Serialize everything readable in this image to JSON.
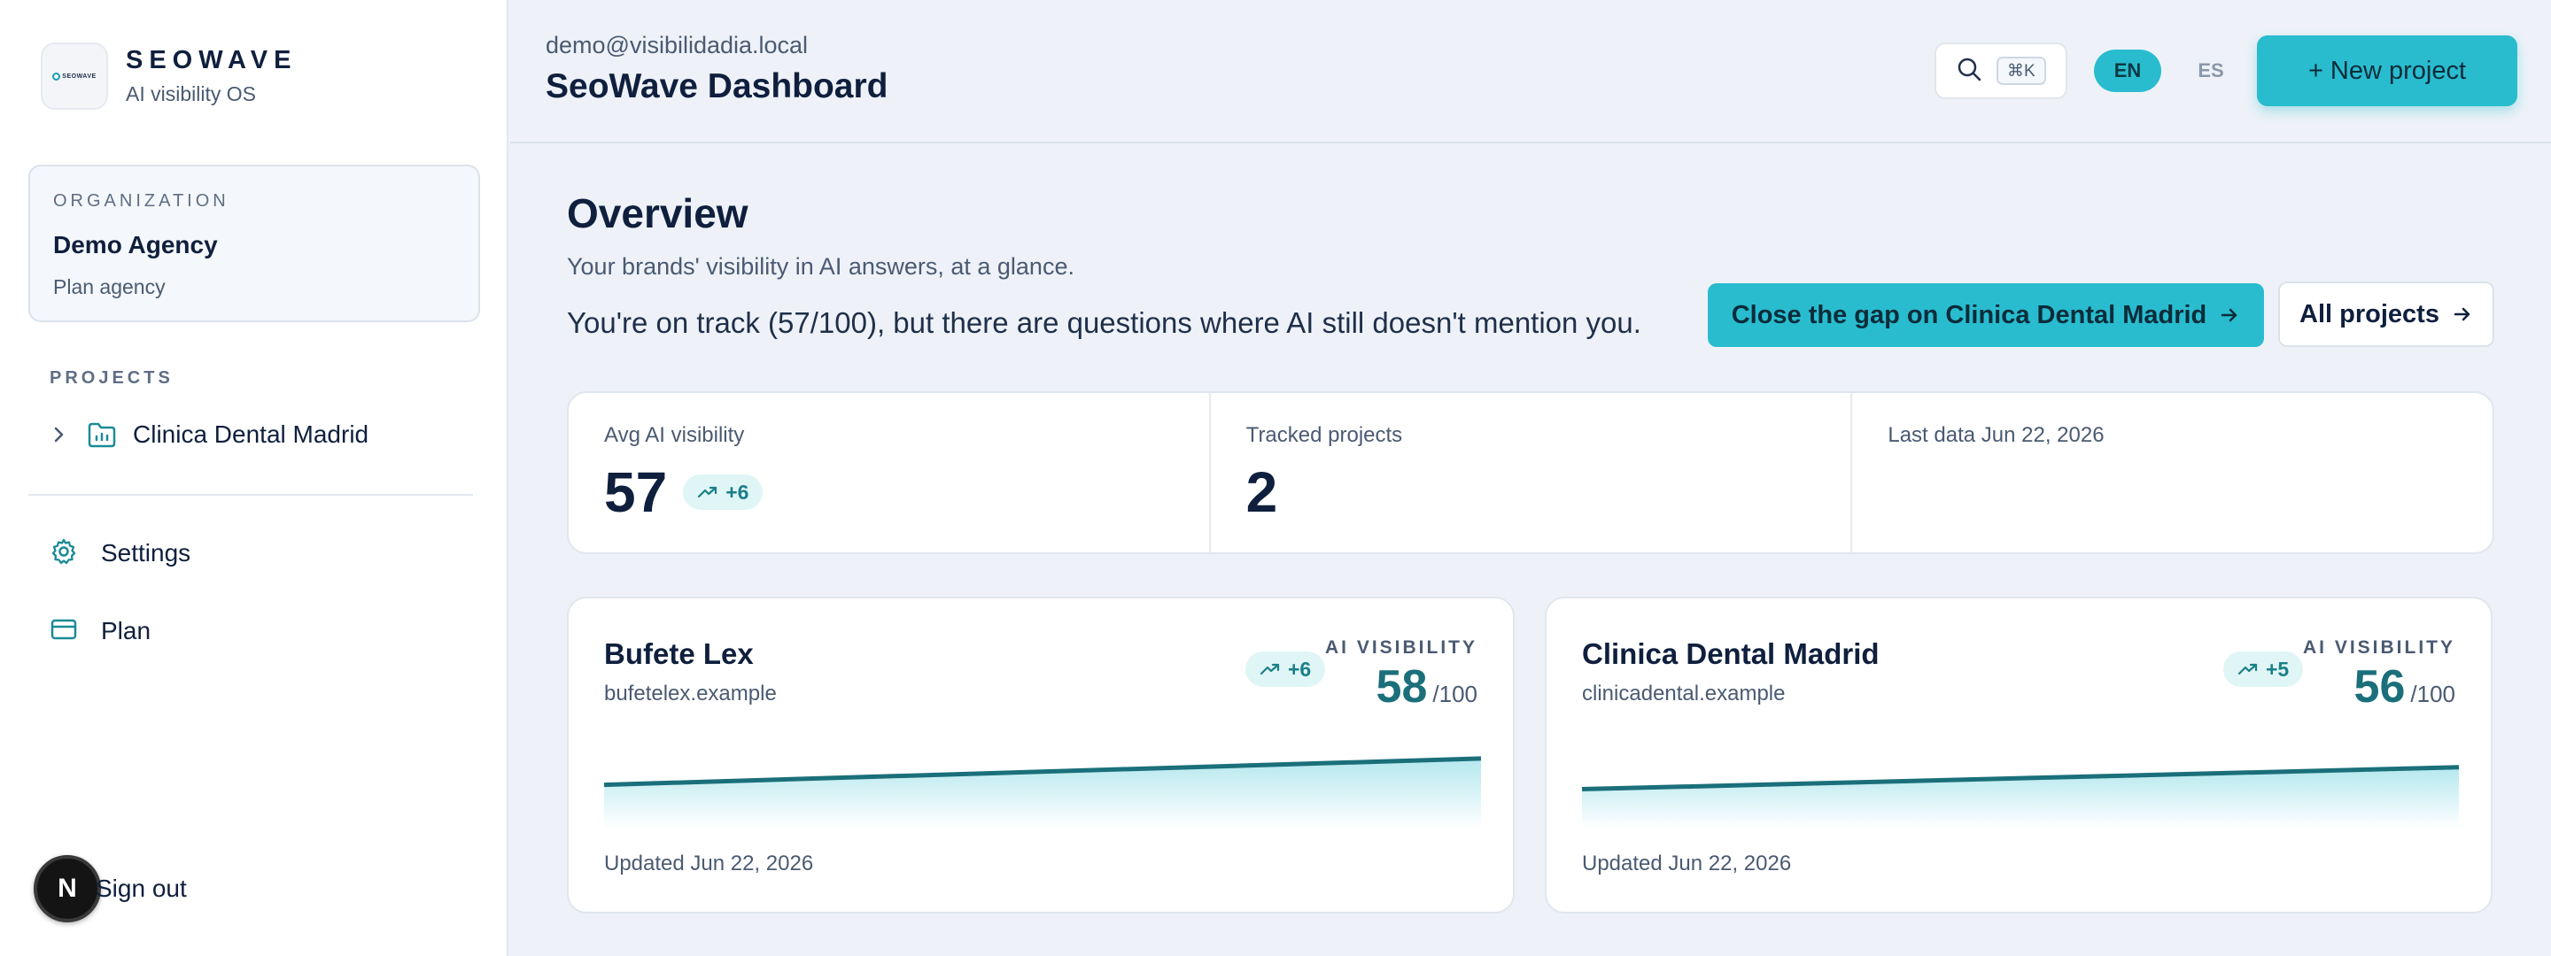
{
  "brand": {
    "name": "SEOWAVE",
    "subtitle": "AI visibility OS",
    "logo_text": "SEOWAVE"
  },
  "organization": {
    "label": "ORGANIZATION",
    "name": "Demo Agency",
    "plan": "Plan agency"
  },
  "sidebar": {
    "projects_label": "PROJECTS",
    "projects": [
      {
        "label": "Clinica Dental Madrid",
        "icon": "folder-icon"
      }
    ],
    "nav": [
      {
        "label": "Settings",
        "icon": "gear-icon"
      },
      {
        "label": "Plan",
        "icon": "credit-card-icon"
      }
    ],
    "signout": {
      "avatar": "N",
      "label": "Sign out"
    }
  },
  "header": {
    "email": "demo@visibilidadia.local",
    "title": "SeoWave Dashboard",
    "search_shortcut": "⌘K",
    "languages": [
      {
        "code": "EN",
        "active": true
      },
      {
        "code": "ES",
        "active": false
      }
    ],
    "new_project_label": "+ New project"
  },
  "overview": {
    "title": "Overview",
    "subtitle": "Your brands' visibility in AI answers, at a glance.",
    "message": "You're on track (57/100), but there are questions where AI still doesn't mention you.",
    "cta_gap": "Close the gap on Clinica Dental Madrid",
    "cta_all": "All projects"
  },
  "stats": {
    "avg_label": "Avg AI visibility",
    "avg_value": "57",
    "avg_delta": "+6",
    "tracked_label": "Tracked projects",
    "tracked_value": "2",
    "last_data_label": "Last data Jun 22, 2026"
  },
  "projects": [
    {
      "name": "Bufete Lex",
      "domain": "bufetelex.example",
      "delta": "+6",
      "visibility_label": "AI VISIBILITY",
      "score": "58",
      "score_den": "/100",
      "updated": "Updated Jun 22, 2026",
      "trend": [
        52,
        58
      ]
    },
    {
      "name": "Clinica Dental Madrid",
      "domain": "clinicadental.example",
      "delta": "+5",
      "visibility_label": "AI VISIBILITY",
      "score": "56",
      "score_den": "/100",
      "updated": "Updated Jun 22, 2026",
      "trend": [
        51,
        56
      ]
    }
  ],
  "colors": {
    "accent": "#29bccf",
    "accent_dark": "#1a6f7a",
    "text": "#0f1f3d",
    "muted": "#4a5a72"
  }
}
